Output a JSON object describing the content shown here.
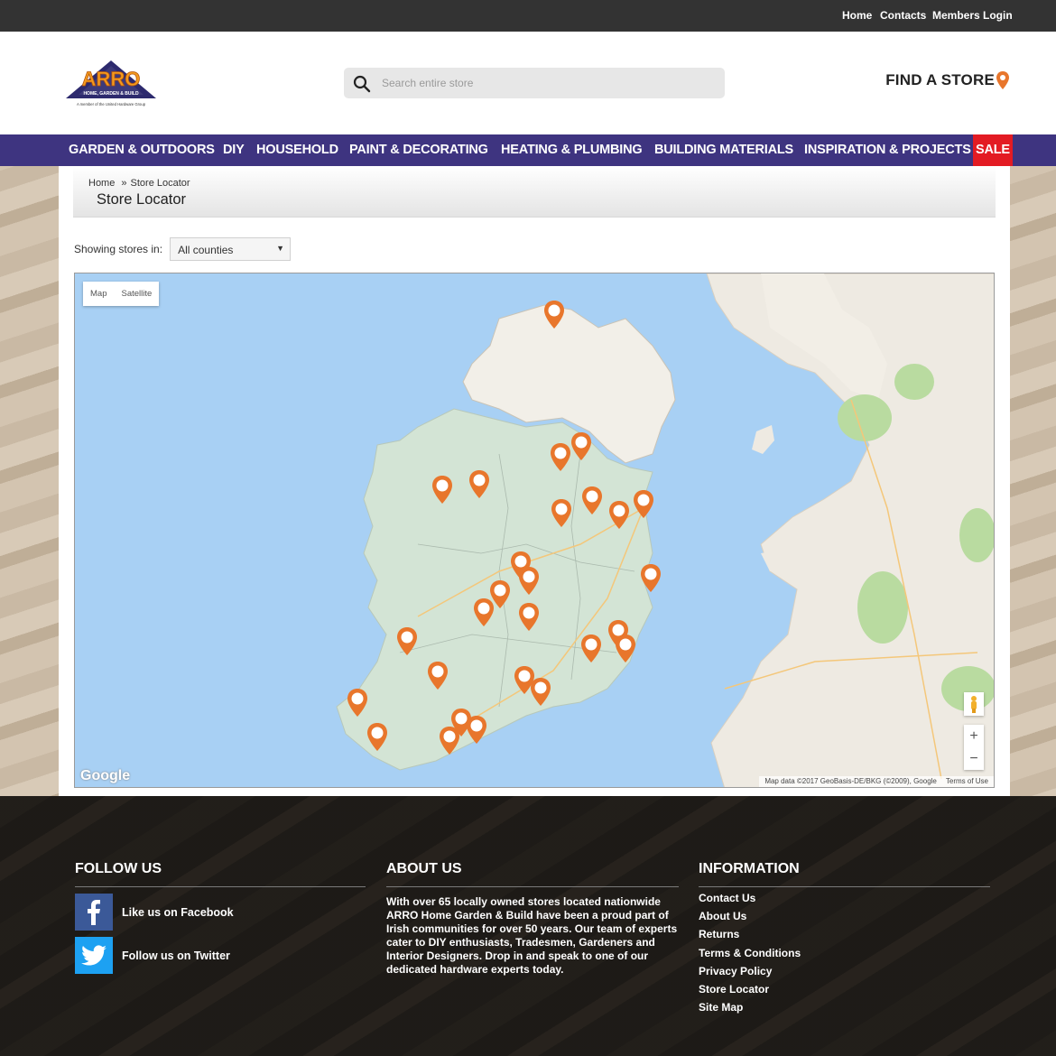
{
  "topbar": {
    "links": [
      "Home",
      "Contacts",
      "Members Login"
    ]
  },
  "header": {
    "logo_text": "ARRO",
    "logo_sub": "HOME, GARDEN & BUILD",
    "logo_tagline": "A member of the United Hardware Group",
    "search_placeholder": "Search entire store",
    "find_store": "FIND A STORE"
  },
  "nav": {
    "items": [
      "GARDEN & OUTDOORS",
      "DIY",
      "HOUSEHOLD",
      "PAINT & DECORATING",
      "HEATING & PLUMBING",
      "BUILDING MATERIALS",
      "INSPIRATION & PROJECTS",
      "SALE"
    ]
  },
  "breadcrumb": {
    "home": "Home",
    "separator": "»",
    "current": "Store Locator"
  },
  "page_title": "Store Locator",
  "filter": {
    "label": "Showing stores in:",
    "selected": "All counties"
  },
  "map": {
    "type_buttons": [
      "Map",
      "Satellite"
    ],
    "google_label": "Google",
    "attribution": "Map data ©2017 GeoBasis-DE/BKG (©2009), Google",
    "terms": "Terms of Use",
    "zoom_in": "+",
    "zoom_out": "−",
    "store_markers": 27
  },
  "footer": {
    "follow": {
      "title": "FOLLOW US",
      "facebook": "Like us on Facebook",
      "twitter": "Follow us on Twitter"
    },
    "about": {
      "title": "ABOUT US",
      "text": "With over 65 locally owned stores located nationwide ARRO Home Garden & Build have been a proud part of Irish communities for over 50 years. Our team of experts cater to DIY enthusiasts, Tradesmen, Gardeners and Interior Designers. Drop in and speak to one of our dedicated hardware experts today."
    },
    "information": {
      "title": "INFORMATION",
      "links": [
        "Contact Us",
        "About Us",
        "Returns",
        "Terms & Conditions",
        "Privacy Policy",
        "Store Locator",
        "Site Map"
      ]
    }
  },
  "colors": {
    "nav": "#3e3480",
    "sale": "#e31b23",
    "marker": "#e8762c",
    "topbar": "#333333"
  }
}
